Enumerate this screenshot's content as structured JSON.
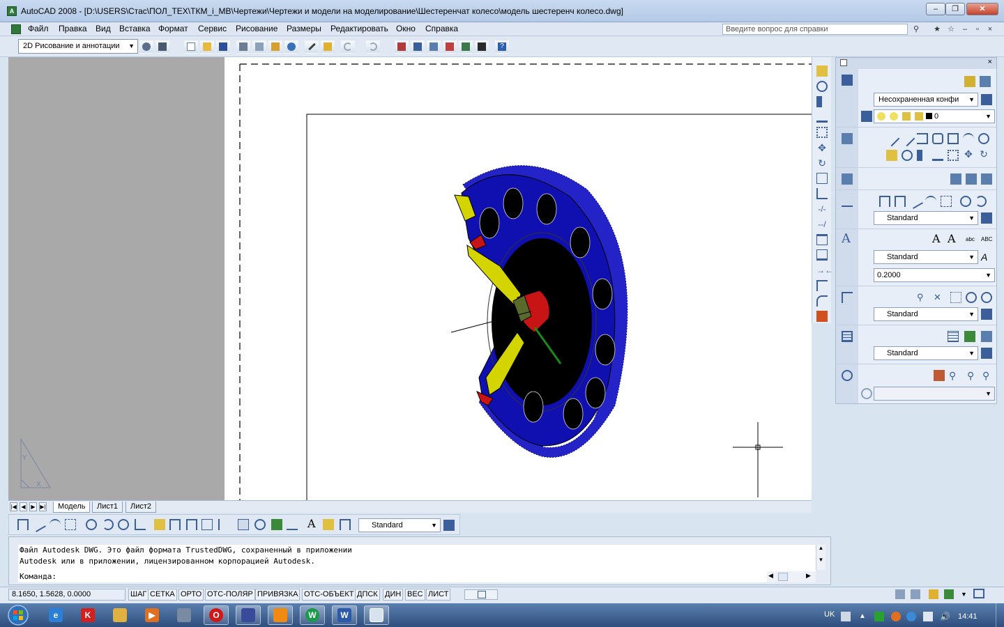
{
  "window": {
    "title": "AutoCAD 2008 - [D:\\USERS\\Стас\\ПОЛ_ТЕХ\\ТКМ_i_МВ\\Чертежи\\Чертежи и модели на моделирование\\Шестеренчат колесо\\модель шестеренч колесо.dwg]",
    "app_icon_text": "A",
    "minimize": "–",
    "restore": "❐",
    "close": "✕"
  },
  "menu": {
    "items": [
      "Файл",
      "Правка",
      "Вид",
      "Вставка",
      "Формат",
      "Сервис",
      "Рисование",
      "Размеры",
      "Редактировать",
      "Окно",
      "Справка"
    ],
    "help_search_placeholder": "Введите вопрос для справки"
  },
  "toolbar": {
    "workspace": "2D Рисование и аннотации"
  },
  "layout_tabs": {
    "tabs": [
      "Модель",
      "Лист1",
      "Лист2"
    ],
    "active": "Модель"
  },
  "dim_toolbar": {
    "dimstyle": "Standard"
  },
  "dashboard": {
    "layer_state": "Несохраненная конфи",
    "current_layer": "0",
    "dim_style": "Standard",
    "text_style": "Standard",
    "text_height": "0.2000",
    "mleader_style": "Standard",
    "table_style": "Standard"
  },
  "command": {
    "history": [
      "Файл Autodesk DWG. Это файл формата TrustedDWG, сохраненный в приложении",
      "Autodesk или в приложении, лицензированном корпорацией Autodesk."
    ],
    "prompt": "Команда:"
  },
  "status": {
    "coords": "8.1650, 1.5628, 0.0000",
    "buttons": [
      "ШАГ",
      "СЕТКА",
      "ОРТО",
      "ОТС-ПОЛЯР",
      "ПРИВЯЗКА",
      "ОТС-ОБЪЕКТ",
      "ДПСК",
      "ДИН",
      "ВЕС",
      "ЛИСТ"
    ]
  },
  "taskbar": {
    "language": "UK",
    "clock": "14:41"
  },
  "colors": {
    "gear_body": "#1010b0",
    "hub_face": "#000000",
    "cut_face": "#d4d400",
    "red_face": "#c81414",
    "axis_green": "#1a8a1a"
  }
}
